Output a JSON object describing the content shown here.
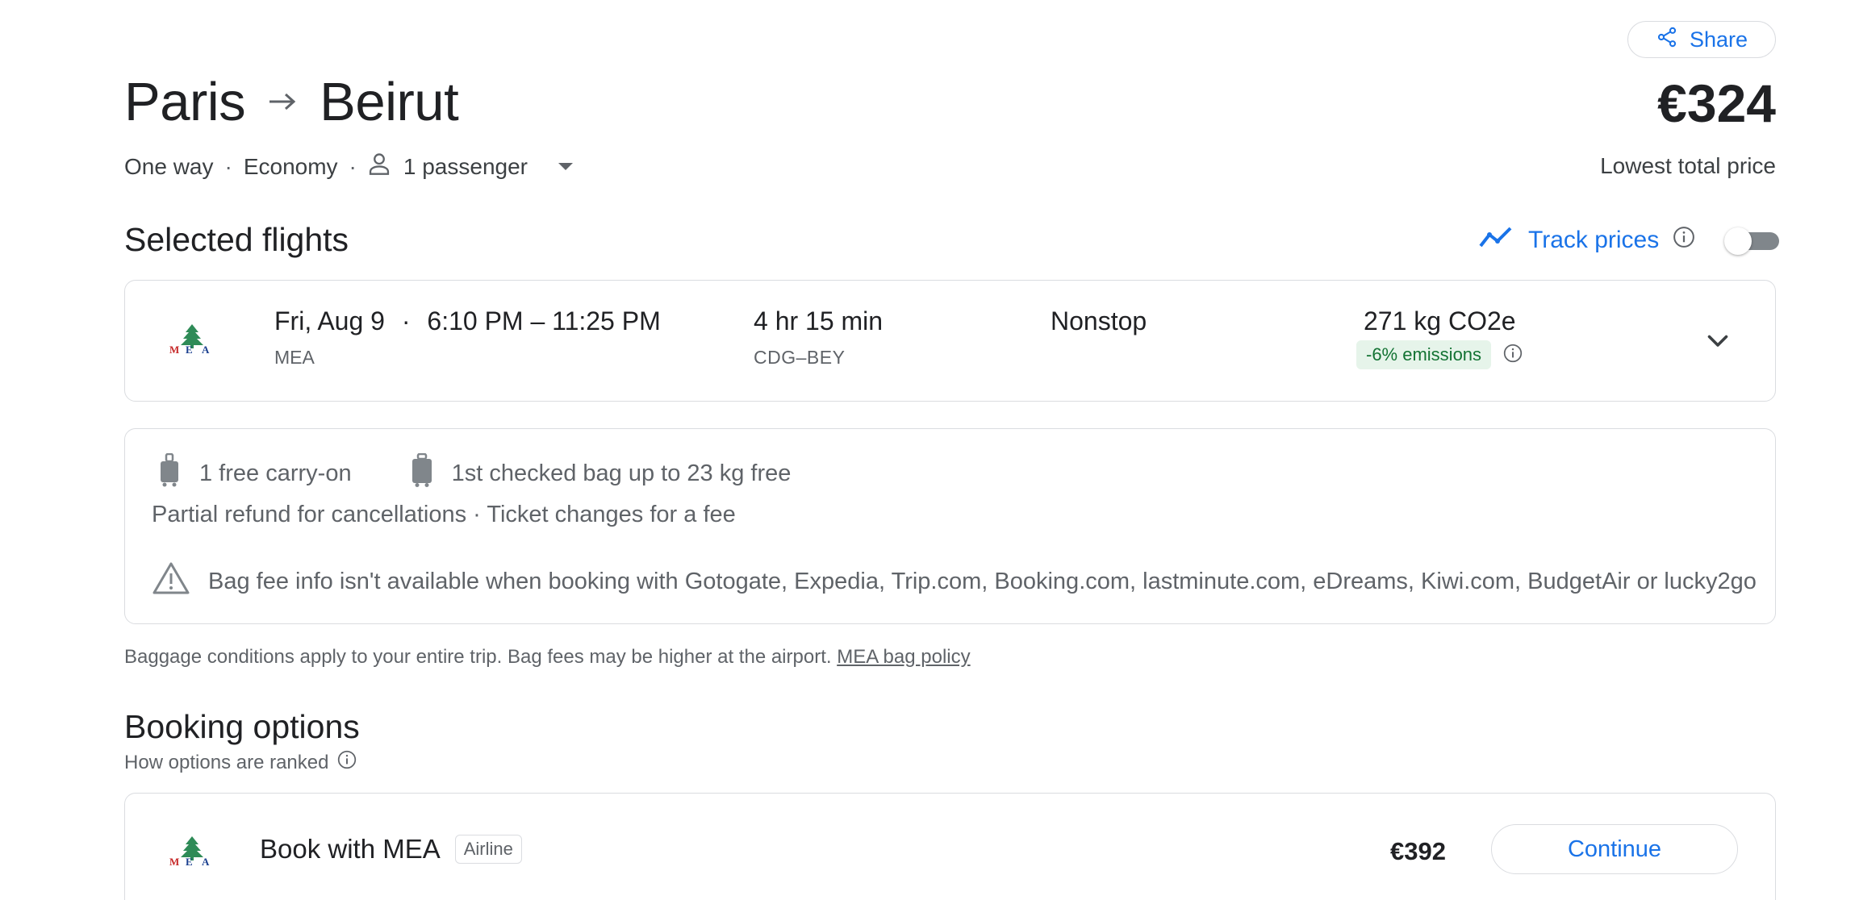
{
  "header": {
    "share_label": "Share",
    "origin": "Paris",
    "destination": "Beirut",
    "price": "€324",
    "price_caption": "Lowest total price",
    "trip_type": "One way",
    "cabin": "Economy",
    "passengers": "1 passenger"
  },
  "selected_flights": {
    "title": "Selected flights",
    "track_prices_label": "Track prices",
    "track_prices_enabled": false
  },
  "flight": {
    "date": "Fri, Aug 9",
    "times": "6:10 PM – 11:25 PM",
    "airline": "MEA",
    "duration": "4 hr 15 min",
    "route": "CDG–BEY",
    "stops": "Nonstop",
    "co2": "271 kg CO2e",
    "emissions_badge": "-6% emissions"
  },
  "baggage": {
    "carry_on": "1 free carry-on",
    "checked": "1st checked bag up to 23 kg free",
    "policy": "Partial refund for cancellations · Ticket changes for a fee",
    "warning": "Bag fee info isn't available when booking with Gotogate, Expedia, Trip.com, Booking.com, lastminute.com, eDreams, Kiwi.com, BudgetAir or lucky2go",
    "note": "Baggage conditions apply to your entire trip. Bag fees may be higher at the airport.",
    "policy_link": "MEA bag policy"
  },
  "booking": {
    "title": "Booking options",
    "ranking_label": "How options are ranked",
    "options": [
      {
        "name": "Book with MEA",
        "tag": "Airline",
        "price": "€392",
        "action": "Continue"
      }
    ]
  },
  "colors": {
    "accent": "#1a73e8",
    "text": "#202124",
    "muted": "#5f6368",
    "border": "#dadce0",
    "emissions_bg": "#e6f4ea",
    "emissions_text": "#137333"
  }
}
